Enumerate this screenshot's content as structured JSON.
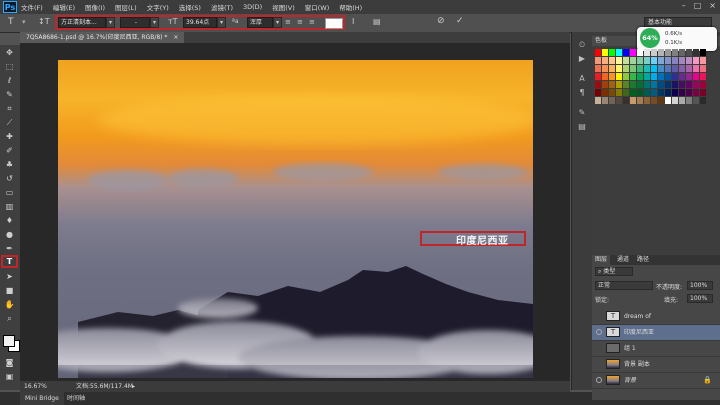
{
  "app": {
    "logo": "Ps"
  },
  "menu": [
    "文件(F)",
    "编辑(E)",
    "图像(I)",
    "图层(L)",
    "文字(Y)",
    "选择(S)",
    "滤镜(T)",
    "3D(D)",
    "视图(V)",
    "窗口(W)",
    "帮助(H)"
  ],
  "window_controls": [
    "–",
    "□",
    "×"
  ],
  "options_bar": {
    "font_family": "方正清刻本...",
    "font_style": "-",
    "font_size": "39.64点",
    "antialias": "浑厚",
    "aa_label": "ªa",
    "text_color": "#ffffff",
    "workspace": "基本功能"
  },
  "document": {
    "tab_title": "7Q5A8686-1.psd @ 16.7%(印度尼西亚, RGB/8) *",
    "close_glyph": "×",
    "zoom": "16.67%",
    "doc_size": "文档:55.6M/117.4M"
  },
  "canvas_text": "印度尼西亚",
  "bottom_tabs": [
    "Mini Bridge",
    "时间轴"
  ],
  "swatches_panel": {
    "title": "色板"
  },
  "net_widget": {
    "percent": "64%",
    "up": "0.6K/s",
    "down": "0.1K/s"
  },
  "layers_panel": {
    "tabs": [
      "图层",
      "通道",
      "路径"
    ],
    "filter_label": "类型",
    "blend_mode": "正常",
    "opacity_label": "不透明度:",
    "opacity": "100%",
    "lock_label": "锁定:",
    "fill_label": "填充:",
    "fill": "100%",
    "layers": [
      {
        "name": "dream of",
        "kind": "text",
        "visible": false,
        "selected": false
      },
      {
        "name": "印度尼西亚",
        "kind": "text",
        "visible": true,
        "selected": true
      },
      {
        "name": "组 1",
        "kind": "group",
        "visible": false,
        "selected": false
      },
      {
        "name": "背景 副本",
        "kind": "image",
        "visible": false,
        "selected": false
      },
      {
        "name": "背景",
        "kind": "image",
        "visible": true,
        "selected": false
      }
    ]
  },
  "colors": {
    "highlight": "#c0252a",
    "selected_layer": "#5d6f8c",
    "accent": "#31a8ff"
  }
}
